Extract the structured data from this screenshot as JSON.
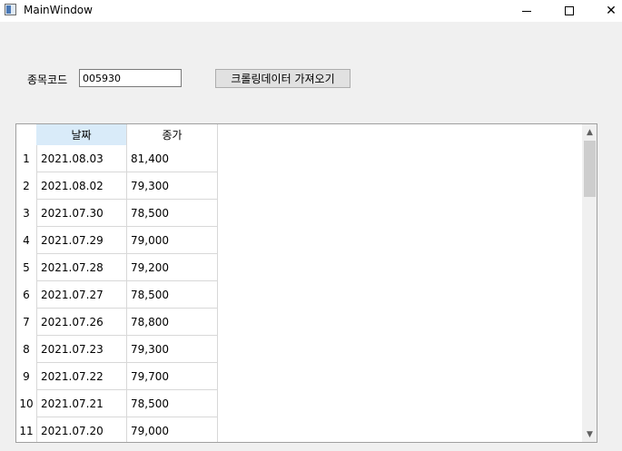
{
  "window": {
    "title": "MainWindow",
    "controls": {
      "minimize": "—",
      "close": "✕"
    }
  },
  "form": {
    "code_label": "종목코드",
    "code_value": "005930",
    "fetch_button": "크롤링데이터 가져오기"
  },
  "table": {
    "columns": [
      "날짜",
      "종가"
    ],
    "rows": [
      {
        "index": "1",
        "date": "2021.08.03",
        "close": "81,400"
      },
      {
        "index": "2",
        "date": "2021.08.02",
        "close": "79,300"
      },
      {
        "index": "3",
        "date": "2021.07.30",
        "close": "78,500"
      },
      {
        "index": "4",
        "date": "2021.07.29",
        "close": "79,000"
      },
      {
        "index": "5",
        "date": "2021.07.28",
        "close": "79,200"
      },
      {
        "index": "6",
        "date": "2021.07.27",
        "close": "78,500"
      },
      {
        "index": "7",
        "date": "2021.07.26",
        "close": "78,800"
      },
      {
        "index": "8",
        "date": "2021.07.23",
        "close": "79,300"
      },
      {
        "index": "9",
        "date": "2021.07.22",
        "close": "79,700"
      },
      {
        "index": "10",
        "date": "2021.07.21",
        "close": "78,500"
      },
      {
        "index": "11",
        "date": "2021.07.20",
        "close": "79,000"
      }
    ],
    "scroll": {
      "up_icon": "▲",
      "down_icon": "▼",
      "position": 0
    }
  },
  "colors": {
    "selected_header": "#d9ebf9",
    "window_bg": "#f0f0f0"
  }
}
